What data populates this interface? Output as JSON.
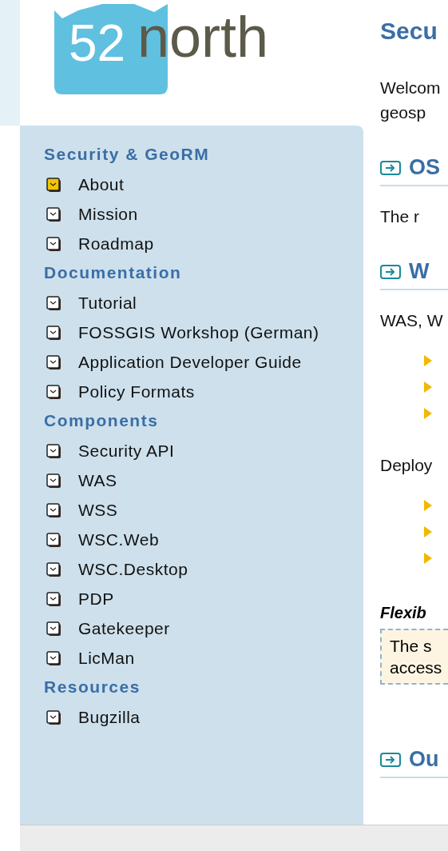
{
  "logo": {
    "digits": "52",
    "word": "north"
  },
  "sidebar": {
    "sections": [
      {
        "title": "Security & GeoRM",
        "items": [
          {
            "label": "About",
            "selected": true
          },
          {
            "label": "Mission",
            "selected": false
          },
          {
            "label": "Roadmap",
            "selected": false
          }
        ]
      },
      {
        "title": "Documentation",
        "items": [
          {
            "label": "Tutorial",
            "selected": false
          },
          {
            "label": "FOSSGIS Workshop (German)",
            "selected": false
          },
          {
            "label": "Application Developer Guide",
            "selected": false
          },
          {
            "label": "Policy Formats",
            "selected": false
          }
        ]
      },
      {
        "title": "Components",
        "items": [
          {
            "label": "Security API",
            "selected": false
          },
          {
            "label": "WAS",
            "selected": false
          },
          {
            "label": "WSS",
            "selected": false
          },
          {
            "label": "WSC.Web",
            "selected": false
          },
          {
            "label": "WSC.Desktop",
            "selected": false
          },
          {
            "label": "PDP",
            "selected": false
          },
          {
            "label": "Gatekeeper",
            "selected": false
          },
          {
            "label": "LicMan",
            "selected": false
          }
        ]
      },
      {
        "title": "Resources",
        "items": [
          {
            "label": "Bugzilla",
            "selected": false
          }
        ]
      }
    ]
  },
  "content": {
    "title": "Secu",
    "blocks": [
      {
        "kind": "paragraph",
        "lines": [
          "Welcom",
          "geosp"
        ]
      },
      {
        "kind": "heading",
        "text": "OS"
      },
      {
        "kind": "paragraph",
        "lines": [
          "The r"
        ]
      },
      {
        "kind": "heading",
        "text": "W"
      },
      {
        "kind": "paragraph",
        "lines": [
          "WAS, W"
        ]
      },
      {
        "kind": "bullets",
        "items": [
          {
            "kind": "arrow"
          },
          {
            "kind": "arrow"
          },
          {
            "kind": "arrow"
          }
        ]
      },
      {
        "kind": "paragraph",
        "lines": [
          "Deploy"
        ]
      },
      {
        "kind": "bullets",
        "items": [
          {
            "kind": "arrow"
          },
          {
            "kind": "arrow"
          },
          {
            "kind": "arrow"
          }
        ]
      },
      {
        "kind": "subheading",
        "text": "Flexib"
      },
      {
        "kind": "note",
        "lines": [
          "The s",
          "access"
        ]
      },
      {
        "kind": "heading",
        "text": "Ou"
      }
    ]
  }
}
